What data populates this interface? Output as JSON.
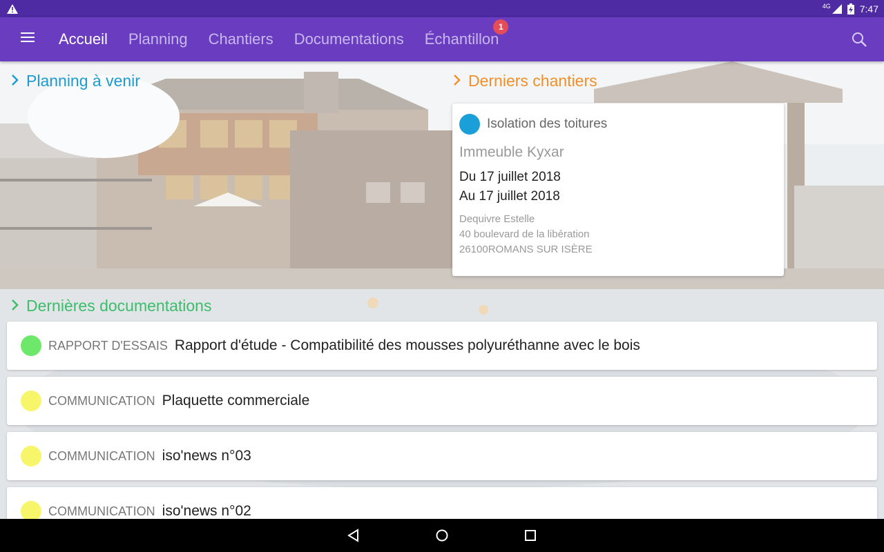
{
  "status_bar": {
    "time": "7:47",
    "network": "4G"
  },
  "app_bar": {
    "tabs": [
      {
        "label": "Accueil",
        "active": true
      },
      {
        "label": "Planning",
        "active": false
      },
      {
        "label": "Chantiers",
        "active": false
      },
      {
        "label": "Documentations",
        "active": false
      },
      {
        "label": "Échantillon",
        "active": false,
        "badge": "1"
      }
    ]
  },
  "sections": {
    "planning": {
      "title": "Planning à venir",
      "color": "#1b9bd1"
    },
    "chantiers": {
      "title": "Derniers chantiers",
      "color": "#f0902a"
    },
    "documentations": {
      "title": "Dernières documentations",
      "color": "#3bbd6a"
    }
  },
  "chantier_card": {
    "dot_color": "#1a9fd8",
    "type": "Isolation des toitures",
    "name": "Immeuble Kyxar",
    "date_from": "Du 17 juillet 2018",
    "date_to": "Au 17 juillet 2018",
    "contact": "Dequivre Estelle",
    "address_line1": "40 boulevard de la libération",
    "address_line2": "26100ROMANS SUR ISÈRE"
  },
  "documentations": [
    {
      "category": "RAPPORT D'ESSAIS",
      "title": "Rapport d'étude - Compatibilité des mousses polyuréthanne avec le bois",
      "dot_color": "#6ee86a"
    },
    {
      "category": "COMMUNICATION",
      "title": "Plaquette commerciale",
      "dot_color": "#f7f56a"
    },
    {
      "category": "COMMUNICATION",
      "title": "iso'news n°03",
      "dot_color": "#f7f56a"
    },
    {
      "category": "COMMUNICATION",
      "title": "iso'news n°02",
      "dot_color": "#f7f56a"
    }
  ],
  "nav_bar": {
    "icons": [
      "back-icon",
      "home-icon",
      "recents-icon"
    ]
  }
}
